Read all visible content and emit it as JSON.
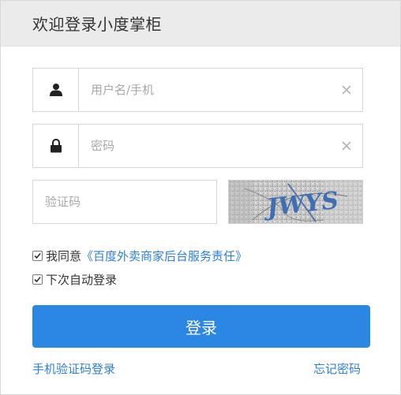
{
  "header": {
    "title": "欢迎登录小度掌柜"
  },
  "username": {
    "placeholder": "用户名/手机",
    "icon": "user-icon"
  },
  "password": {
    "placeholder": "密码",
    "icon": "lock-icon"
  },
  "captcha": {
    "placeholder": "验证码",
    "image_text": "JWYS"
  },
  "agree": {
    "checked": true,
    "prefix": "我同意",
    "link": "《百度外卖商家后台服务责任》"
  },
  "auto_login": {
    "checked": true,
    "label": "下次自动登录"
  },
  "login_button": {
    "label": "登录"
  },
  "links": {
    "sms_login": "手机验证码登录",
    "forgot_password": "忘记密码"
  },
  "colors": {
    "accent": "#2c86e3",
    "link": "#2d7fd8",
    "header_bg": "#ebebeb"
  }
}
